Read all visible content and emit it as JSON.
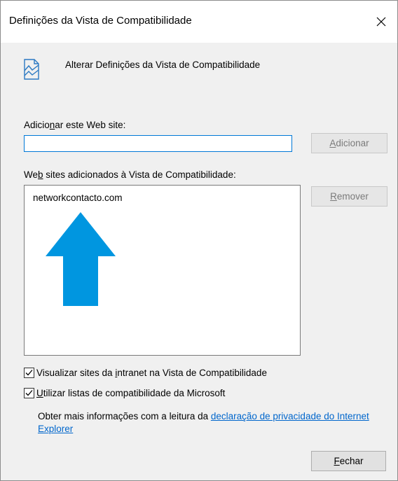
{
  "window": {
    "title": "Definições da Vista de Compatibilidade",
    "close_symbol": "✕"
  },
  "header": {
    "icon": "compat-view-page-icon",
    "text": "Alterar Definições da Vista de Compatibilidade"
  },
  "add_section": {
    "label_pre": "Adicio",
    "label_accel": "n",
    "label_post": "ar este Web site:",
    "input_value": "",
    "add_button_accel": "A",
    "add_button_rest": "dicionar"
  },
  "sites_section": {
    "label_pre": "We",
    "label_accel": "b",
    "label_post": " sites adicionados à Vista de Compatibilidade:",
    "items": [
      "networkcontacto.com"
    ],
    "remove_button_accel": "R",
    "remove_button_rest": "emover"
  },
  "options": {
    "intranet_checked": true,
    "intranet_pre": "Visualizar sites da ",
    "intranet_accel": "i",
    "intranet_post": "ntranet na Vista de Compatibilidade",
    "msft_checked": true,
    "msft_accel": "U",
    "msft_post": "tilizar listas de compatibilidade da Microsoft"
  },
  "privacy": {
    "text": "Obter mais informações com a leitura da ",
    "link": "declaração de privacidade do Internet Explorer"
  },
  "footer": {
    "close_accel": "F",
    "close_rest": "echar"
  },
  "colors": {
    "arrow": "#0096e0",
    "link": "#0066cc",
    "focus_border": "#0078d7"
  }
}
